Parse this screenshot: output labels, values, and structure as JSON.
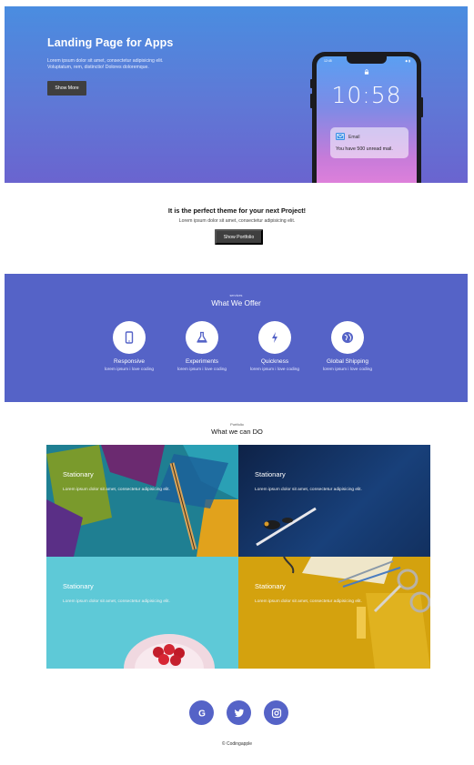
{
  "hero": {
    "title": "Landing Page for Apps",
    "text_line1": "Lorem ipsum dolor sit amet, consectetur adipisicing elit.",
    "text_line2": "Voluptatum, rem, distinctio! Dolores doloremque.",
    "button_label": "Show More",
    "background_colors": [
      "#4a8de0",
      "#6a64cf"
    ]
  },
  "phone": {
    "time": "10:58",
    "status_left": "12:45",
    "status_right": "◆ ▮",
    "notification": {
      "app": "Email",
      "message": "You have 500 unread mail.",
      "icon": "mail-icon"
    }
  },
  "intro": {
    "title": "It is the perfect theme for your next Project!",
    "text": "Lorem ipsum dolor sit amet, consectetur adipisicing elit.",
    "button_label": "Show Portfolio"
  },
  "services": {
    "subtitle": "services",
    "title": "What We Offer",
    "background_color": "#5563c7",
    "items": [
      {
        "name": "Responsive",
        "desc": "lorem ipsum i love coding",
        "icon": "mobile-icon"
      },
      {
        "name": "Experiments",
        "desc": "lorem ipsum i love coding",
        "icon": "flask-icon"
      },
      {
        "name": "Quickness",
        "desc": "lorem ipsum i love coding",
        "icon": "lightning-icon"
      },
      {
        "name": "Global Shipping",
        "desc": "lorem ipsum i love coding",
        "icon": "globe-icon"
      }
    ]
  },
  "portfolio": {
    "subtitle": "Portfolio",
    "title": "What we can DO",
    "tiles": [
      {
        "title": "Stationary",
        "text": "Lorem ipsum dolor sit amet, consectetur adipisicing elit."
      },
      {
        "title": "Stationary",
        "text": "Lorem ipsum dolor sit amet, consectetur adipisicing elit."
      },
      {
        "title": "Stationary",
        "text": "Lorem ipsum dolor sit amet, consectetur adipisicing elit."
      },
      {
        "title": "Stationary",
        "text": "Lorem ipsum dolor sit amet, consectetur adipisicing elit."
      }
    ]
  },
  "footer": {
    "social": [
      {
        "icon": "google-icon",
        "glyph": "G"
      },
      {
        "icon": "twitter-icon"
      },
      {
        "icon": "instagram-icon"
      }
    ],
    "copyright": "© Codingapple"
  }
}
